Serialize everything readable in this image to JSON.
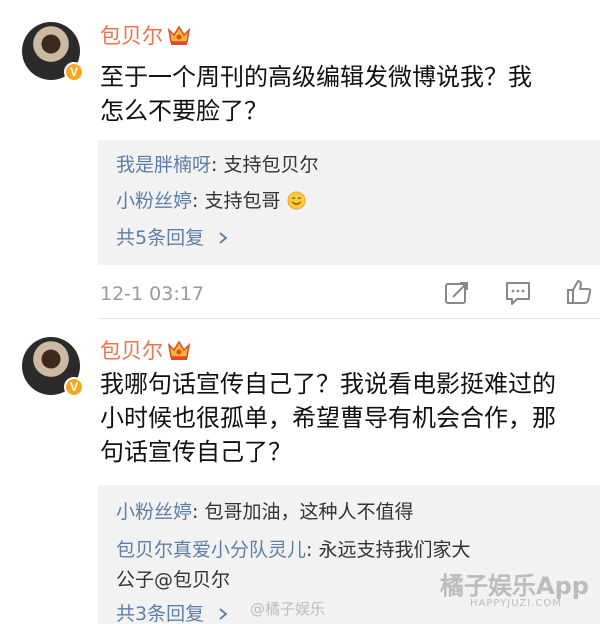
{
  "colors": {
    "username": "#eb7350",
    "link": "#5d7fa7",
    "reply_bg": "#f2f2f2",
    "muted": "#999999"
  },
  "comments": [
    {
      "username": "包贝尔",
      "text_lines": [
        "至于一个周刊的高级编辑发微博说我？我",
        "怎么不要脸了？"
      ],
      "replies": [
        {
          "nick": "我是胖楠呀",
          "text": ": 支持包贝尔"
        },
        {
          "nick": "小粉丝婷",
          "text": ": 支持包哥"
        }
      ],
      "more_replies": "共5条回复",
      "time": "12-1 03:17"
    },
    {
      "username": "包贝尔",
      "text_lines": [
        "我哪句话宣传自己了？我说看电影挺难过的",
        "小时候也很孤单，希望曹导有机会合作，那",
        "句话宣传自己了？"
      ],
      "replies": [
        {
          "nick": "小粉丝婷",
          "text": ": 包哥加油，这种人不值得"
        },
        {
          "nick": "包贝尔真爱小分队灵儿",
          "text": ": 永远支持我们家大"
        },
        {
          "nick": "",
          "text": "公子@包贝尔"
        }
      ],
      "more_replies": "共3条回复"
    }
  ],
  "watermark": {
    "app": "橘子娱乐App",
    "site": "HAPPYJUZI.COM",
    "weibo": "@橘子娱乐"
  },
  "icons": [
    "crown-icon",
    "verified-icon",
    "smile-emoji-icon",
    "chevron-right-icon",
    "repost-icon",
    "comment-icon",
    "like-icon"
  ]
}
